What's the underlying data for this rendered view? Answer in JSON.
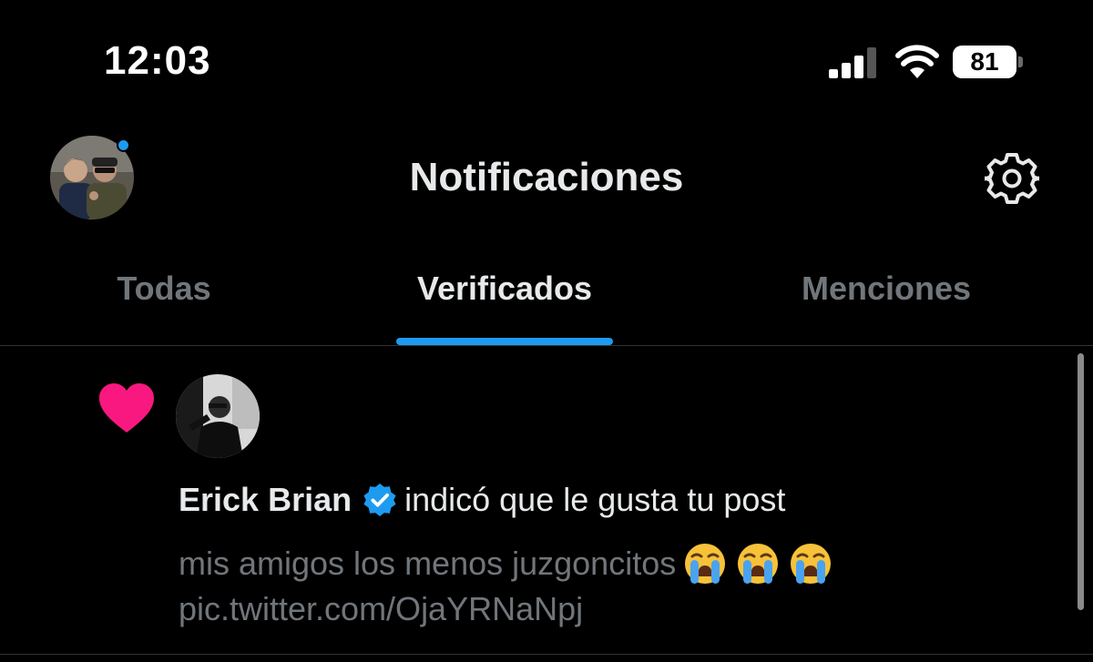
{
  "status_bar": {
    "time": "12:03",
    "battery": "81",
    "signal_icon": "cellular-signal-icon",
    "wifi_icon": "wifi-icon"
  },
  "header": {
    "title": "Notificaciones",
    "settings_icon": "gear-icon"
  },
  "tabs": [
    {
      "label": "Todas",
      "active": false
    },
    {
      "label": "Verificados",
      "active": true
    },
    {
      "label": "Menciones",
      "active": false
    }
  ],
  "notification": {
    "type_icon": "heart-icon",
    "actor_name": "Erick Brian",
    "verified": true,
    "action": "indicó que le gusta tu post",
    "post_text": "mis amigos los menos juzgoncitos",
    "post_emojis": [
      "loudly-crying-face",
      "loudly-crying-face",
      "loudly-crying-face"
    ],
    "post_link": "pic.twitter.com/OjaYRNaNpj"
  },
  "colors": {
    "background": "#000000",
    "accent": "#1d9bf0",
    "like": "#f91880",
    "muted_text": "#71767b",
    "primary_text": "#e7e9ea"
  }
}
